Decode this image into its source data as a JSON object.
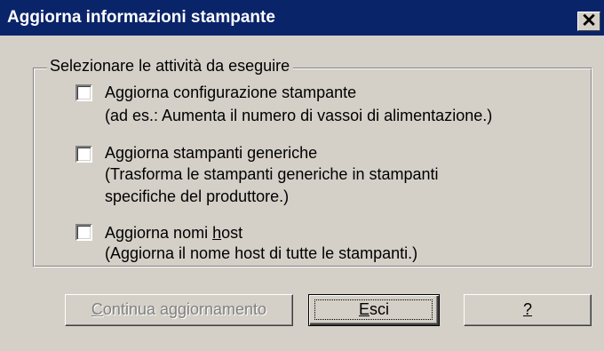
{
  "window": {
    "title": "Aggiorna informazioni stampante",
    "close_symbol": "✕"
  },
  "group": {
    "legend": "Selezionare le attività da eseguire"
  },
  "options": [
    {
      "checked": false,
      "label": "Aggiorna configurazione stampante",
      "description": [
        "(ad es.: Aumenta il numero di vassoi di alimentazione.)"
      ]
    },
    {
      "checked": false,
      "label": "Aggiorna stampanti generiche",
      "description": [
        "(Trasforma le stampanti generiche in stampanti",
        "specifiche del produttore.)"
      ]
    },
    {
      "checked": false,
      "label_pre": "Aggiorna nomi ",
      "label_accel": "h",
      "label_post": "ost",
      "description": [
        "(Aggiorna il nome host di tutte le stampanti.)"
      ]
    }
  ],
  "buttons": {
    "continue": {
      "accel": "C",
      "rest": "ontinua aggiornamento",
      "enabled": false
    },
    "exit": {
      "accel": "E",
      "rest": "sci"
    },
    "help": {
      "accel": "?",
      "rest": ""
    }
  }
}
